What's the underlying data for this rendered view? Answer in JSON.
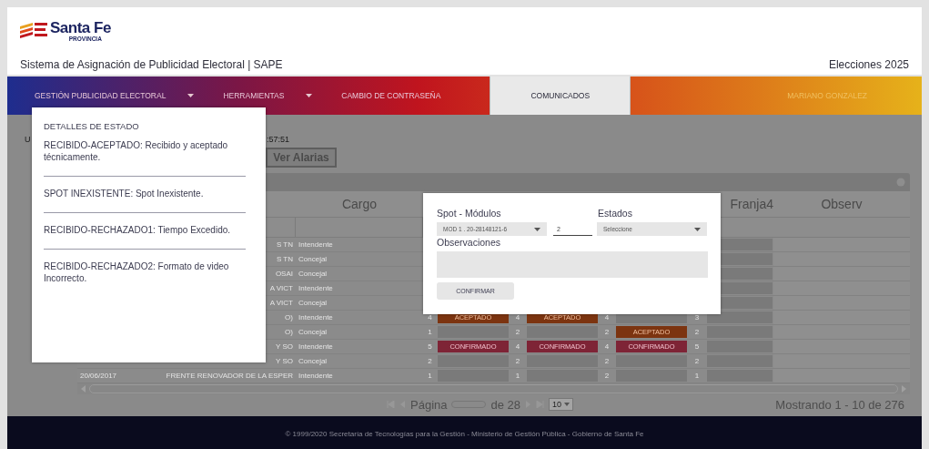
{
  "header": {
    "logo": {
      "name": "Santa Fe",
      "sub": "PROVINCIA"
    },
    "title": "Sistema de Asignación de Publicidad Electoral | SAPE",
    "election": "Elecciones 2025"
  },
  "nav": {
    "items": [
      {
        "label": "GESTIÓN PUBLICIDAD ELECTORAL",
        "dropdown": true,
        "selected": false
      },
      {
        "label": "HERRAMIENTAS",
        "dropdown": true,
        "selected": false
      },
      {
        "label": "CAMBIO DE CONTRASEÑA",
        "dropdown": false,
        "selected": false
      },
      {
        "label": "COMUNICADOS",
        "dropdown": false,
        "selected": true
      }
    ],
    "user": "MARIANO GONZALEZ"
  },
  "info_line": [
    "U",
    ":57:51"
  ],
  "alerts_button": "Ver Alarias",
  "table": {
    "columns": [
      "Cargo",
      "Franja4",
      "Observ"
    ],
    "rows": [
      {
        "party": "S TN",
        "cargo": "Intendente",
        "franjas": [
          {
            "status": {
              "kind": "empty"
            }
          }
        ]
      },
      {
        "party": "S TN",
        "cargo": "Concejal",
        "franjas": [
          {
            "status": {
              "kind": "empty"
            }
          }
        ]
      },
      {
        "party": "OSAI",
        "cargo": "Concejal",
        "franjas": [
          {
            "status": {
              "kind": "empty"
            }
          }
        ]
      },
      {
        "party": "A VICT",
        "cargo": "Intendente",
        "franjas": [
          {
            "status": {
              "kind": "empty"
            }
          }
        ]
      },
      {
        "party": "A VICT",
        "cargo": "Concejal",
        "franjas": [
          {
            "status": {
              "kind": "empty"
            }
          }
        ]
      },
      {
        "party": "O)",
        "cargo": "Intendente",
        "franjas": [
          {
            "number": "4",
            "status": {
              "kind": "accepted",
              "label": "ACEPTADO"
            }
          },
          {
            "number": "4",
            "status": {
              "kind": "accepted",
              "label": "ACEPTADO"
            }
          },
          {
            "number": "4",
            "status": {
              "kind": "empty"
            }
          },
          {
            "number": "3",
            "status": {
              "kind": "empty"
            }
          }
        ]
      },
      {
        "party": "O)",
        "cargo": "Concejal",
        "franjas": [
          {
            "number": "1",
            "status": {
              "kind": "empty"
            }
          },
          {
            "number": "2",
            "status": {
              "kind": "empty"
            }
          },
          {
            "number": "2",
            "status": {
              "kind": "accepted",
              "label": "ACEPTADO"
            }
          },
          {
            "number": "2",
            "status": {
              "kind": "empty"
            }
          }
        ]
      },
      {
        "party": "Y SO",
        "cargo": "Intendente",
        "franjas": [
          {
            "number": "5",
            "status": {
              "kind": "confirmed",
              "label": "CONFIRMADO"
            }
          },
          {
            "number": "4",
            "status": {
              "kind": "confirmed",
              "label": "CONFIRMADO"
            }
          },
          {
            "number": "4",
            "status": {
              "kind": "confirmed",
              "label": "CONFIRMADO"
            }
          },
          {
            "number": "5",
            "status": {
              "kind": "empty"
            }
          }
        ]
      },
      {
        "party": "Y SO",
        "cargo": "Concejal",
        "franjas": [
          {
            "number": "2",
            "status": {
              "kind": "empty"
            }
          },
          {
            "number": "2",
            "status": {
              "kind": "empty"
            }
          },
          {
            "number": "2",
            "status": {
              "kind": "empty"
            }
          },
          {
            "number": "2",
            "status": {
              "kind": "empty"
            }
          }
        ]
      },
      {
        "date": "20/06/2017",
        "party": "FRENTE RENOVADOR DE LA ESPER",
        "cargo": "Intendente",
        "franjas": [
          {
            "number": "1",
            "status": {
              "kind": "empty"
            }
          },
          {
            "number": "1",
            "status": {
              "kind": "empty"
            }
          },
          {
            "number": "2",
            "status": {
              "kind": "empty"
            }
          },
          {
            "number": "1",
            "status": {
              "kind": "empty"
            }
          }
        ]
      }
    ]
  },
  "pagination": {
    "label": "Página",
    "of": "de 28",
    "page_size": "10",
    "summary": "Mostrando 1 - 10 de 276"
  },
  "status_popup": {
    "title": "DETALLES DE ESTADO",
    "items": [
      "RECIBIDO-ACEPTADO: Recibido y aceptado técnicamente.",
      "SPOT INEXISTENTE: Spot Inexistente.",
      "RECIBIDO-RECHAZADO1: Tiempo Excedido.",
      "RECIBIDO-RECHAZADO2: Formato de video Incorrecto."
    ]
  },
  "spot_dialog": {
    "spot_label": "Spot - Módulos",
    "spot_value": "MOD 1 . 20-28148121-6",
    "count_value": "2",
    "states_label": "Estados",
    "states_value": "Seleccione",
    "notes_label": "Observaciones",
    "confirm": "CONFIRMAR"
  },
  "footer": "© 1999/2020 Secretaría de Tecnologías para la Gestión - Ministerio de Gestión Pública - Gobierno de Santa Fe"
}
